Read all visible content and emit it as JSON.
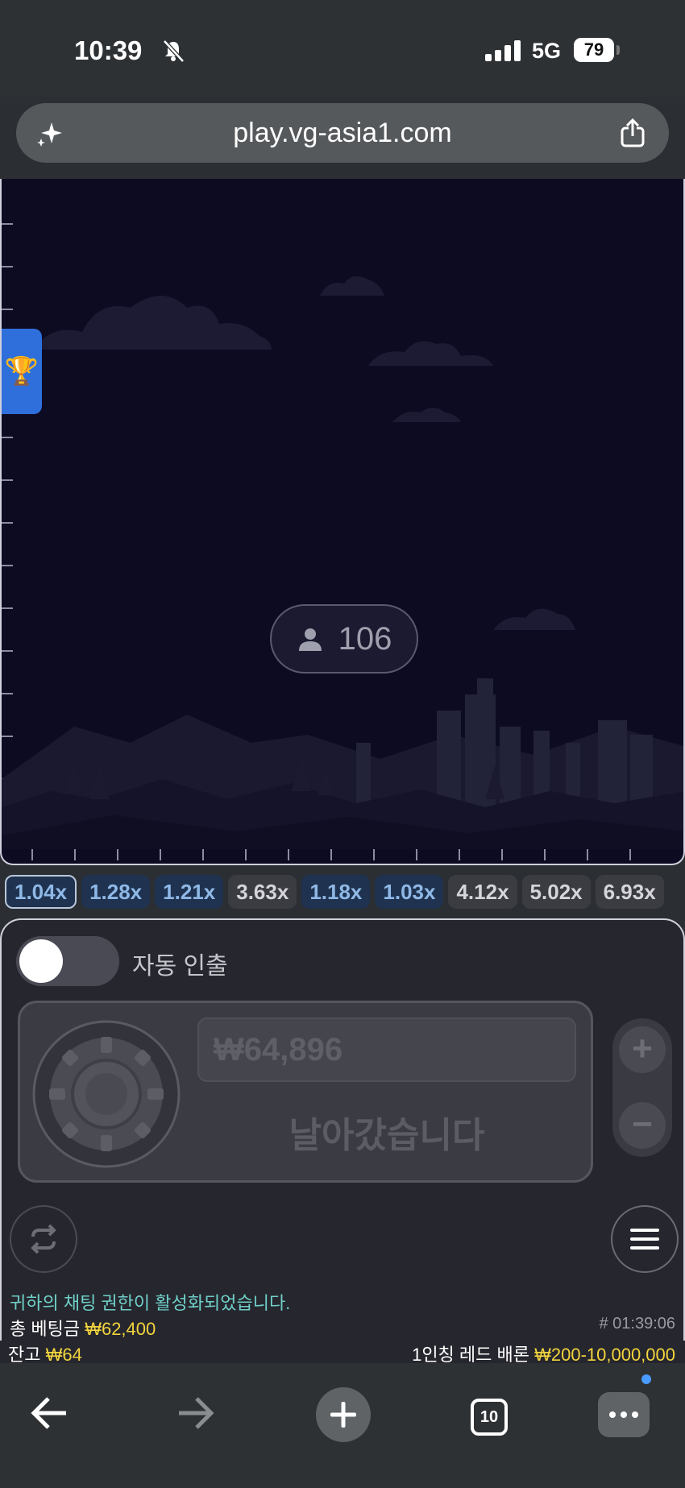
{
  "status_bar": {
    "time": "10:39",
    "network": "5G",
    "battery": "79"
  },
  "browser": {
    "url": "play.vg-asia1.com",
    "tab_count": "10"
  },
  "game": {
    "players_count": "106"
  },
  "history": [
    {
      "value": "1.04x",
      "color": "blue",
      "selected": true
    },
    {
      "value": "1.28x",
      "color": "blue"
    },
    {
      "value": "1.21x",
      "color": "blue"
    },
    {
      "value": "3.63x",
      "color": "gray"
    },
    {
      "value": "1.18x",
      "color": "blue"
    },
    {
      "value": "1.03x",
      "color": "blue"
    },
    {
      "value": "4.12x",
      "color": "gray"
    },
    {
      "value": "5.02x",
      "color": "gray"
    },
    {
      "value": "6.93x",
      "color": "gray"
    }
  ],
  "bet_panel": {
    "auto_cashout_label": "자동 인출",
    "auto_cashout_enabled": false,
    "bet_amount": "₩64,896",
    "status_text": "날아갔습니다",
    "plus_label": "+",
    "minus_label": "−"
  },
  "footer": {
    "chat_message": "귀하의 채팅 권한이 활성화되었습니다.",
    "total_bet_label": "총 베팅금 ",
    "total_bet_value": "₩62,400",
    "round_time": "# 01:39:06",
    "balance_label": "잔고 ",
    "balance_value": "₩64",
    "limit_label": "1인칭 레드 배론 ",
    "limit_value": "₩200-10,000,000"
  },
  "colors": {
    "accent_gold": "#f2d43d",
    "chip_blue": "#8fb8e6",
    "chat_teal": "#6fd0c8",
    "game_bg": "#0d0b22"
  }
}
